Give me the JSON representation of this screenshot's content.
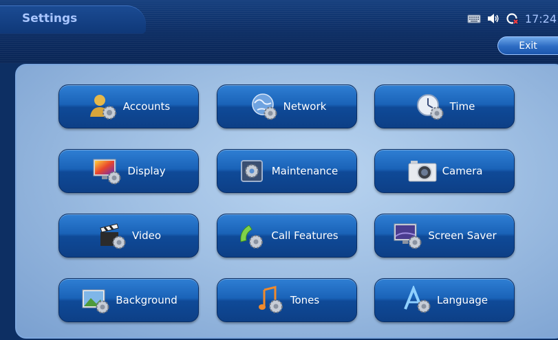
{
  "header": {
    "title": "Settings",
    "clock": "17:24",
    "exit_label": "Exit",
    "status_icons": [
      "keyboard-icon",
      "speaker-icon",
      "network-status-icon"
    ]
  },
  "menu": {
    "items": [
      {
        "label": "Accounts",
        "icon": "accounts-icon"
      },
      {
        "label": "Network",
        "icon": "network-icon"
      },
      {
        "label": "Time",
        "icon": "time-icon"
      },
      {
        "label": "Display",
        "icon": "display-icon"
      },
      {
        "label": "Maintenance",
        "icon": "maintenance-icon"
      },
      {
        "label": "Camera",
        "icon": "camera-icon"
      },
      {
        "label": "Video",
        "icon": "video-icon"
      },
      {
        "label": "Call Features",
        "icon": "call-features-icon"
      },
      {
        "label": "Screen Saver",
        "icon": "screen-saver-icon"
      },
      {
        "label": "Background",
        "icon": "background-icon"
      },
      {
        "label": "Tones",
        "icon": "tones-icon"
      },
      {
        "label": "Language",
        "icon": "language-icon"
      }
    ]
  },
  "colors": {
    "accent_text": "#a9c6ff",
    "tile_blue": "#1a63b8",
    "panel_light": "#b9d4f0"
  }
}
